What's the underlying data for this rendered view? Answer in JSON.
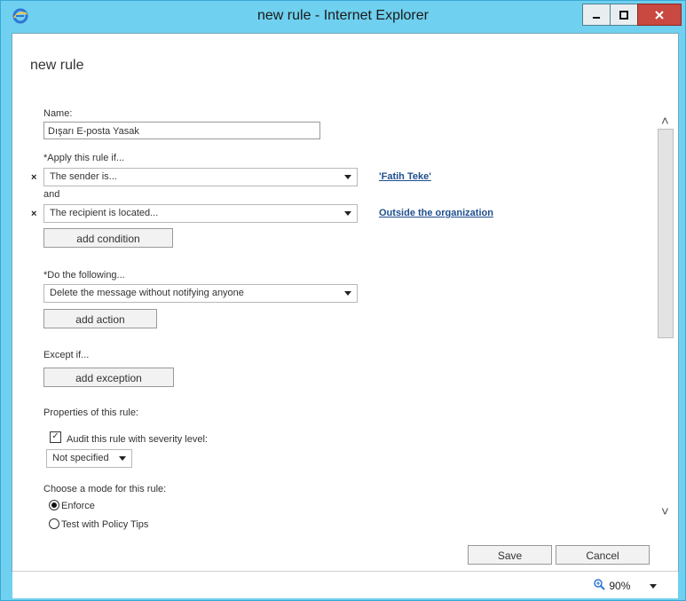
{
  "window": {
    "title": "new rule - Internet Explorer"
  },
  "page": {
    "title": "new rule"
  },
  "form": {
    "name_label": "Name:",
    "name_value": "Dışarı E-posta Yasak",
    "apply_label": "*Apply this rule if...",
    "conditions": [
      {
        "remove": "×",
        "select": "The sender is...",
        "link": "'Fatih Teke'"
      },
      {
        "remove": "×",
        "select": "The recipient is located...",
        "link": "Outside the organization"
      }
    ],
    "and_label": "and",
    "add_condition": "add condition",
    "do_label": "*Do the following...",
    "action_select": "Delete the message without notifying anyone",
    "add_action": "add action",
    "except_label": "Except if...",
    "add_exception": "add exception",
    "properties_label": "Properties of this rule:",
    "audit_label": "Audit this rule with severity level:",
    "audit_checked": true,
    "severity_select": "Not specified",
    "mode_label": "Choose a mode for this rule:",
    "mode_options": [
      "Enforce",
      "Test with Policy Tips"
    ],
    "mode_selected": "Enforce",
    "save": "Save",
    "cancel": "Cancel"
  },
  "status": {
    "zoom": "90%"
  },
  "icons": {
    "browser": "internet-explorer-icon",
    "minimize": "minimize-icon",
    "maximize": "maximize-icon",
    "close": "close-icon",
    "zoom": "zoom-icon"
  },
  "colors": {
    "titlebar": "#6fd0ef",
    "close": "#c9483f",
    "link": "#1f4f8f"
  }
}
